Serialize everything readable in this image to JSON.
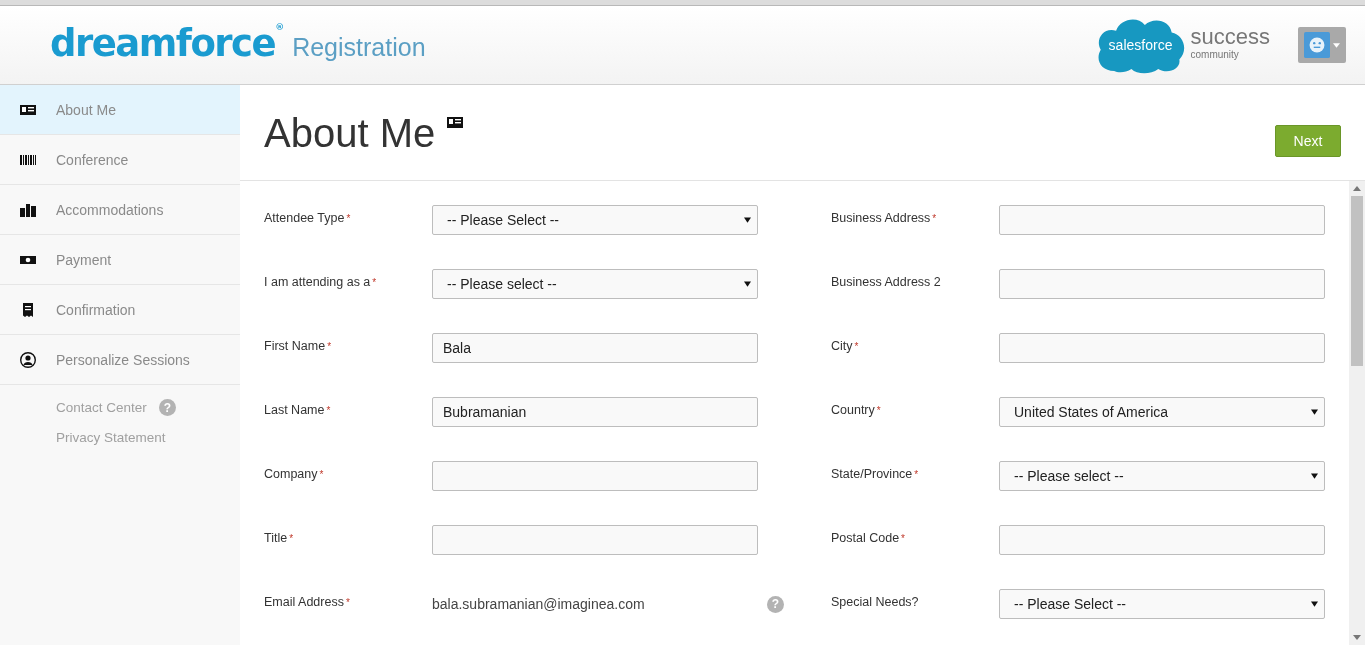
{
  "header": {
    "brand": "dreamforce",
    "brand_mark": "®",
    "subtitle": "Registration",
    "partner_logo": "salesforce",
    "partner_title": "success",
    "partner_subtitle": "community"
  },
  "sidebar": {
    "items": [
      {
        "label": "About Me",
        "selected": true
      },
      {
        "label": "Conference",
        "selected": false
      },
      {
        "label": "Accommodations",
        "selected": false
      },
      {
        "label": "Payment",
        "selected": false
      },
      {
        "label": "Confirmation",
        "selected": false
      },
      {
        "label": "Personalize Sessions",
        "selected": false
      }
    ],
    "links": [
      {
        "label": "Contact Center",
        "help": "?"
      },
      {
        "label": "Privacy Statement"
      }
    ]
  },
  "page": {
    "title": "About Me",
    "next_button": "Next"
  },
  "form": {
    "required_mark": "*",
    "columns": [
      [
        {
          "label": "Attendee Type",
          "required": true,
          "kind": "select",
          "value": "-- Please Select --"
        },
        {
          "label": "I am attending as a",
          "required": true,
          "kind": "select",
          "value": "-- Please select --"
        },
        {
          "label": "First Name",
          "required": true,
          "kind": "text",
          "value": "Bala"
        },
        {
          "label": "Last Name",
          "required": true,
          "kind": "text",
          "value": "Bubramanian"
        },
        {
          "label": "Company",
          "required": true,
          "kind": "text"
        },
        {
          "label": "Title",
          "required": true,
          "kind": "text"
        },
        {
          "label": "Email Address",
          "required": true,
          "kind": "static",
          "value": "bala.subramanian@imaginea.com",
          "help": "?"
        }
      ],
      [
        {
          "label": "Business Address",
          "required": true,
          "kind": "text"
        },
        {
          "label": "Business Address 2",
          "required": false,
          "kind": "text"
        },
        {
          "label": "City",
          "required": true,
          "kind": "text"
        },
        {
          "label": "Country",
          "required": true,
          "kind": "select",
          "value": "United States of America"
        },
        {
          "label": "State/Province",
          "required": true,
          "kind": "select",
          "value": "-- Please select --"
        },
        {
          "label": "Postal Code",
          "required": true,
          "kind": "text"
        },
        {
          "label": "Special Needs?",
          "required": false,
          "kind": "select",
          "value": "-- Please Select --"
        }
      ]
    ]
  }
}
